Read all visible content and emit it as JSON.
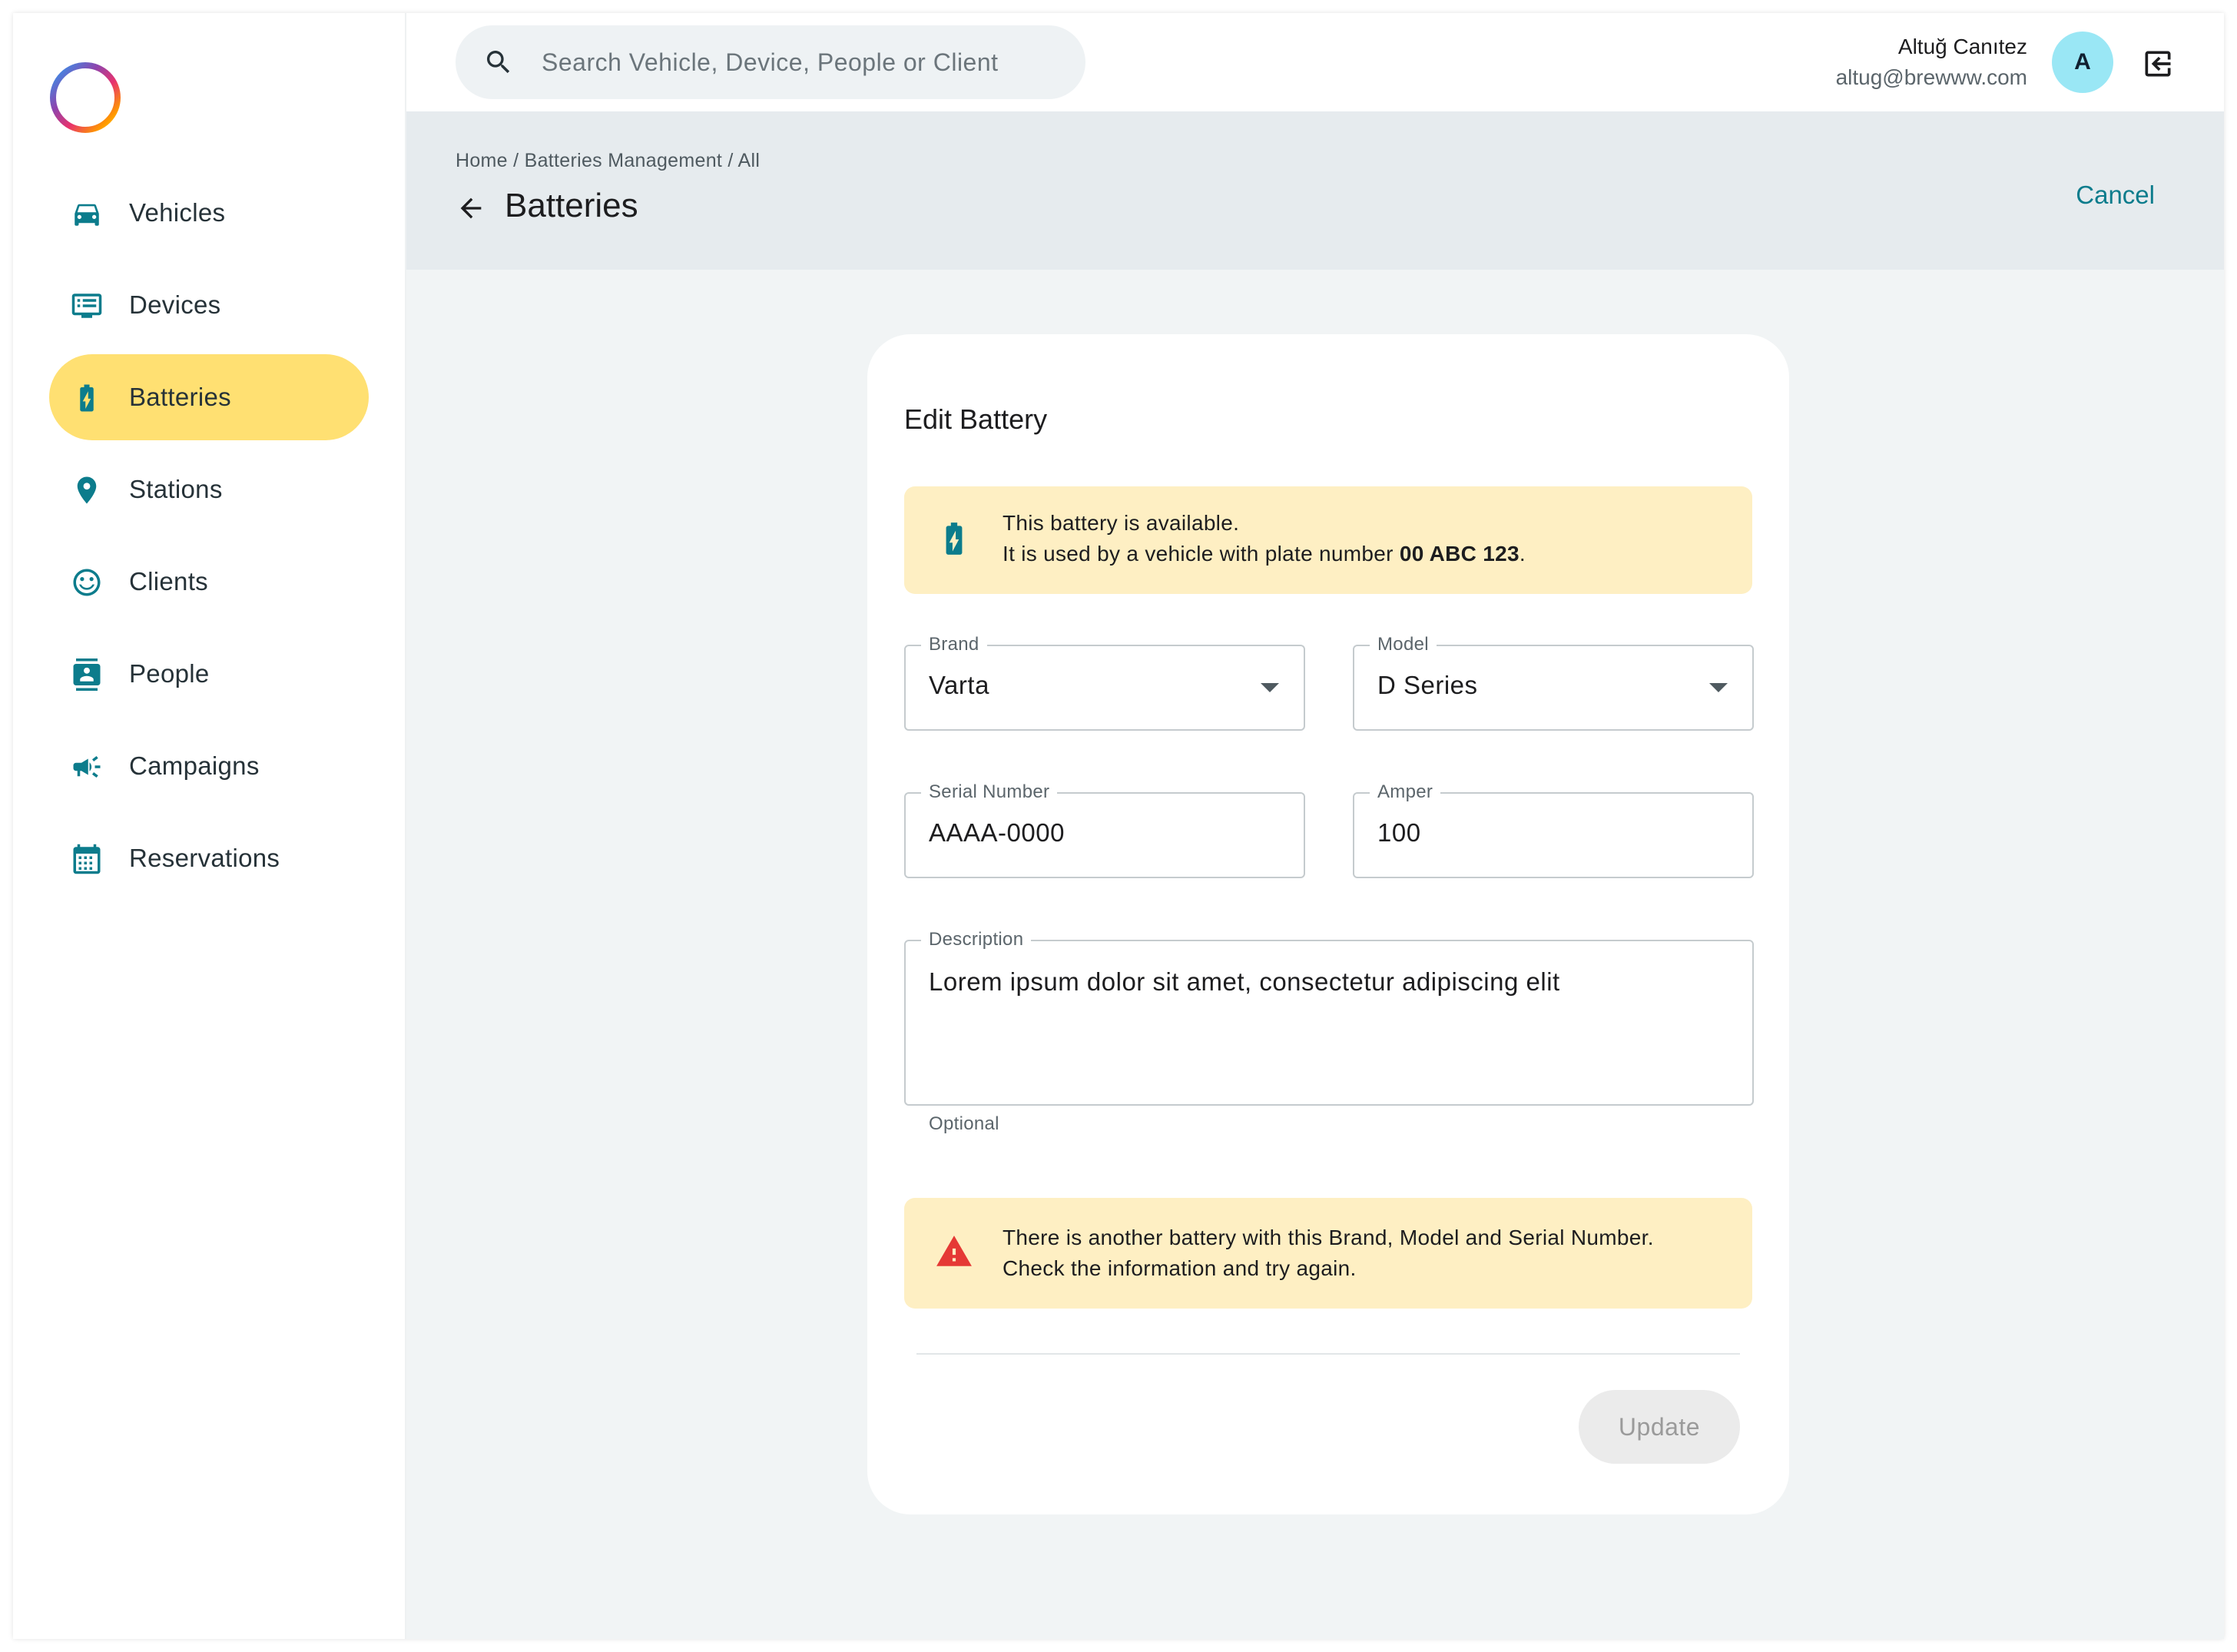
{
  "sidebar": {
    "items": [
      {
        "label": "Vehicles",
        "icon": "car-icon"
      },
      {
        "label": "Devices",
        "icon": "device-icon"
      },
      {
        "label": "Batteries",
        "icon": "battery-icon",
        "active": true
      },
      {
        "label": "Stations",
        "icon": "location-pin-icon"
      },
      {
        "label": "Clients",
        "icon": "smiley-icon"
      },
      {
        "label": "People",
        "icon": "contact-card-icon"
      },
      {
        "label": "Campaigns",
        "icon": "megaphone-icon"
      },
      {
        "label": "Reservations",
        "icon": "calendar-icon"
      }
    ]
  },
  "search": {
    "placeholder": "Search Vehicle, Device, People or Client"
  },
  "user": {
    "name": "Altuğ Canıtez",
    "email": "altug@brewww.com",
    "avatar_initial": "A"
  },
  "header": {
    "breadcrumb": "Home / Batteries Management / All",
    "title": "Batteries",
    "cancel_label": "Cancel"
  },
  "card": {
    "title": "Edit Battery",
    "info_alert": {
      "line1": "This battery is available.",
      "line2_prefix": "It is used by a vehicle with plate number ",
      "plate": "00 ABC 123",
      "line2_suffix": "."
    },
    "fields": {
      "brand": {
        "label": "Brand",
        "value": "Varta"
      },
      "model": {
        "label": "Model",
        "value": "D Series"
      },
      "serial": {
        "label": "Serial Number",
        "value": "AAAA-0000"
      },
      "amper": {
        "label": "Amper",
        "value": "100"
      },
      "description": {
        "label": "Description",
        "value": "Lorem ipsum dolor sit amet, consectetur adipiscing elit",
        "helper": "Optional"
      }
    },
    "warning_alert": "There is another battery with this Brand, Model and Serial Number. Check the information and try again.",
    "update_label": "Update"
  },
  "colors": {
    "accent": "#0c7c8c",
    "active_nav": "#ffe072",
    "alert_bg": "#feefc3",
    "error": "#e53935",
    "avatar_bg": "#9ae7f5"
  }
}
